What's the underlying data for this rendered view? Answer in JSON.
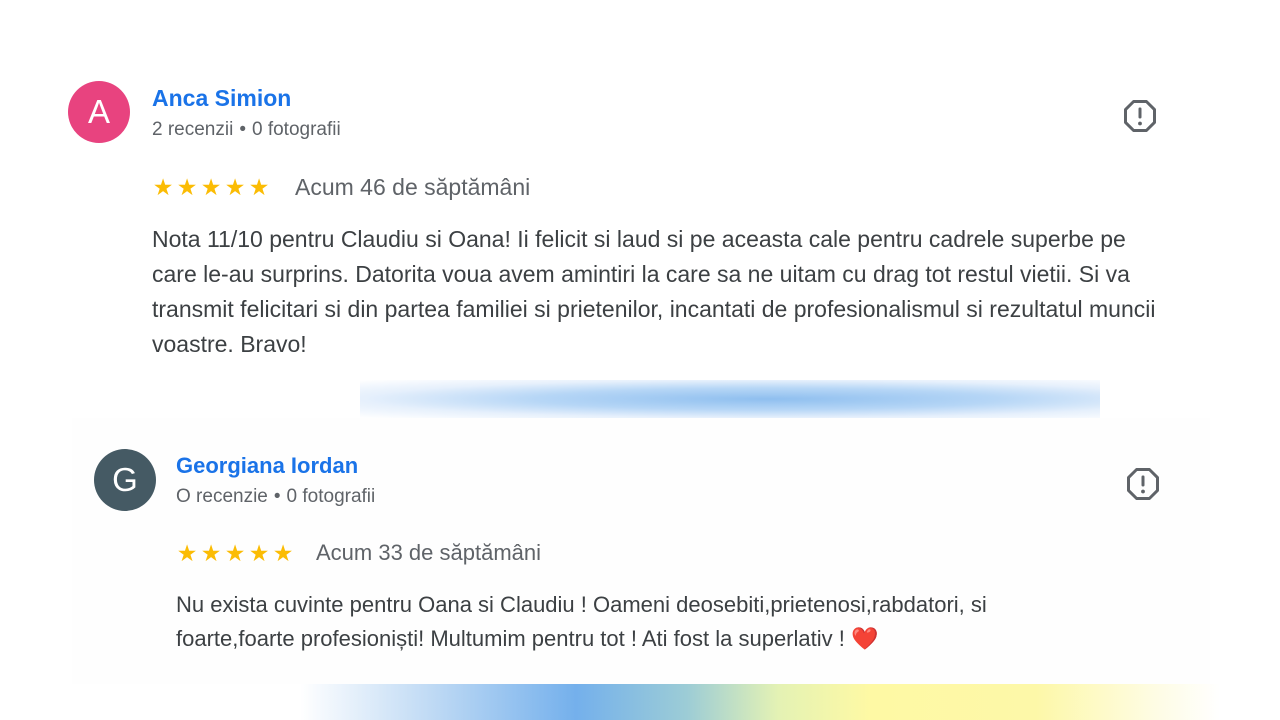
{
  "reviews": [
    {
      "avatar_letter": "A",
      "avatar_color": "#e8437f",
      "name": "Anca Simion",
      "reviews_count": "2 recenzii",
      "separator": "•",
      "photos_count": "0 fotografii",
      "rating": 5,
      "star_glyphs": [
        "★",
        "★",
        "★",
        "★",
        "★"
      ],
      "time": "Acum 46 de săptămâni",
      "text": "Nota 11/10 pentru Claudiu si Oana! Ii felicit si laud si pe aceasta cale pentru cadrele superbe pe care le-au surprins. Datorita voua avem amintiri la care sa ne uitam cu drag tot restul vietii. Si va transmit felicitari si din partea familiei si prietenilor, incantati de profesionalismul si rezultatul muncii voastre. Bravo!"
    },
    {
      "avatar_letter": "G",
      "avatar_color": "#455a64",
      "name": "Georgiana Iordan",
      "reviews_count": "O recenzie",
      "separator": "•",
      "photos_count": "0 fotografii",
      "rating": 5,
      "star_glyphs": [
        "★",
        "★",
        "★",
        "★",
        "★"
      ],
      "time": "Acum 33 de săptămâni",
      "text": "Nu exista cuvinte pentru Oana si Claudiu ! Oameni deosebiti,prietenosi,rabdatori, si foarte,foarte profesioniști! Multumim pentru tot ! Ati fost la superlativ ! ❤️"
    }
  ],
  "icons": {
    "flag": "report-flag-icon",
    "star": "star-icon"
  },
  "colors": {
    "name_link": "#1a73e8",
    "star": "#fbbc04",
    "meta": "#5f6368",
    "body_text": "#3c4043"
  }
}
